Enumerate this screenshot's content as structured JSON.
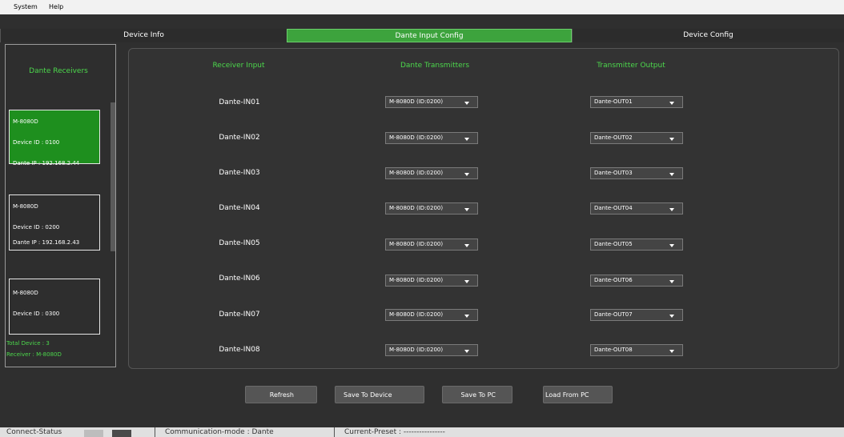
{
  "menu": [
    "System",
    "Help"
  ],
  "tabs": [
    "Device Info",
    "Dante Input Config",
    "Device Config"
  ],
  "sidebar": {
    "title": "Dante Receivers",
    "devices": [
      {
        "model": "M-8080D",
        "id": "Device ID : 0100",
        "ip": "Dante IP : 192.168.2.44"
      },
      {
        "model": "M-8080D",
        "id": "Device ID : 0200",
        "ip": "Dante IP : 192.168.2.43"
      },
      {
        "model": "M-8080D",
        "id": "Device ID : 0300"
      }
    ],
    "total": "Total Device : 3",
    "receiver": "Receiver : M-8080D"
  },
  "columns": {
    "receiver_input": "Receiver Input",
    "transmitters": "Dante Transmitters",
    "output": "Transmitter Output"
  },
  "rows": [
    {
      "input": "Dante-IN01",
      "transmitter": "M-8080D (ID:0200)",
      "output": "Dante-OUT01"
    },
    {
      "input": "Dante-IN02",
      "transmitter": "M-8080D (ID:0200)",
      "output": "Dante-OUT02"
    },
    {
      "input": "Dante-IN03",
      "transmitter": "M-8080D (ID:0200)",
      "output": "Dante-OUT03"
    },
    {
      "input": "Dante-IN04",
      "transmitter": "M-8080D (ID:0200)",
      "output": "Dante-OUT04"
    },
    {
      "input": "Dante-IN05",
      "transmitter": "M-8080D (ID:0200)",
      "output": "Dante-OUT05"
    },
    {
      "input": "Dante-IN06",
      "transmitter": "M-8080D (ID:0200)",
      "output": "Dante-OUT06"
    },
    {
      "input": "Dante-IN07",
      "transmitter": "M-8080D (ID:0200)",
      "output": "Dante-OUT07"
    },
    {
      "input": "Dante-IN08",
      "transmitter": "M-8080D (ID:0200)",
      "output": "Dante-OUT08"
    }
  ],
  "buttons": {
    "refresh": "Refresh",
    "save_device": "Save To Device",
    "save_pc": "Save To PC",
    "load_pc": "Load From PC"
  },
  "status": {
    "connect": "Connect-Status",
    "comm": "Communication-mode : Dante",
    "preset": "Current-Preset : ----------------"
  },
  "colors": {
    "accent_green": "#3da33d",
    "label_green": "#4cd84c"
  },
  "icons": {
    "dropdown": "chevron-down-icon"
  }
}
